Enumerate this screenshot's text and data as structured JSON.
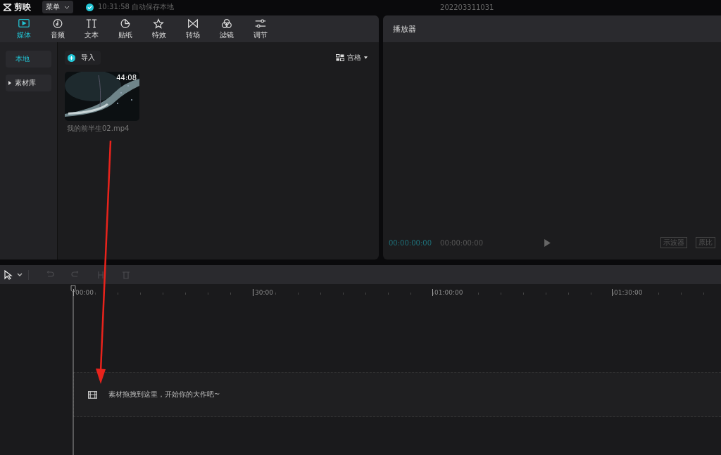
{
  "app": {
    "name": "剪映",
    "menu": "菜单",
    "save_status": "10:31:58 自动保存本地",
    "project_title": "202203311031"
  },
  "tabs": [
    {
      "label": "媒体",
      "kind": "media",
      "selected": true
    },
    {
      "label": "音频",
      "kind": "audio",
      "selected": false
    },
    {
      "label": "文本",
      "kind": "text",
      "selected": false
    },
    {
      "label": "贴纸",
      "kind": "sticker",
      "selected": false
    },
    {
      "label": "特效",
      "kind": "effect",
      "selected": false
    },
    {
      "label": "转场",
      "kind": "transition",
      "selected": false
    },
    {
      "label": "滤镜",
      "kind": "filter",
      "selected": false
    },
    {
      "label": "调节",
      "kind": "adjust",
      "selected": false
    }
  ],
  "sidebar": {
    "items": [
      {
        "label": "本地",
        "selected": true,
        "kind": "plain"
      },
      {
        "label": "素材库",
        "selected": false,
        "kind": "folder"
      }
    ]
  },
  "media": {
    "import_button": "导入",
    "view_toggle": "宫格",
    "clips": [
      {
        "duration": "44:08",
        "filename": "我的前半生02.mp4",
        "kind": "picture"
      }
    ]
  },
  "player": {
    "title": "播放器",
    "current_time": "00:00:00:00",
    "total_time": "00:00:00:00",
    "buttons": [
      "示波器",
      "原比"
    ]
  },
  "timeline": {
    "ruler": [
      "00:00",
      "30:00",
      "01:00:00",
      "01:30:00"
    ],
    "drop_hint": "素材拖拽到这里，开始你的大作吧~"
  }
}
